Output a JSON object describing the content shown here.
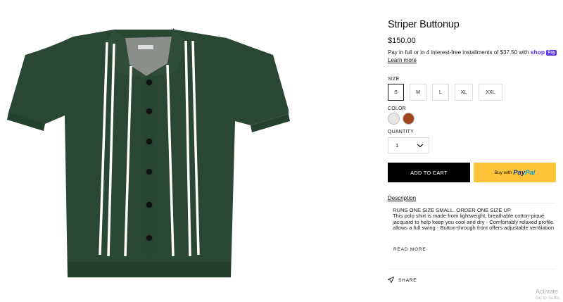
{
  "product": {
    "title": "Striper Buttonup",
    "price": "$150.00",
    "installments_text": "Pay in full or in 4 interest-free installments of $37.50 with",
    "shoppay_label": "shop",
    "shoppay_badge": "Pay",
    "learn_more": "Learn more",
    "image_alt": "Dark green knit short-sleeve polo buttonup with white vertical stripes"
  },
  "size": {
    "label": "SIZE",
    "options": [
      "S",
      "M",
      "L",
      "XL",
      "XXL"
    ],
    "selected": "S"
  },
  "color": {
    "label": "COLOR",
    "swatches": [
      "#e6e6e6",
      "#a0461c"
    ]
  },
  "quantity": {
    "label": "QUANTITY",
    "value": "1"
  },
  "actions": {
    "add_to_cart": "ADD TO CART",
    "buy_with": "Buy with",
    "paypal_pay": "Pay",
    "paypal_pal": "Pal"
  },
  "description": {
    "heading": "Description",
    "line1": "RUNS ONE SIZE SMALL. ORDER ONE SIZE UP",
    "body": "This polo shirt is made from lightweight, breathable cotton-piqué jacquard to help keep you cool and dry - Comfortably relaxed profile allows a full swing - Button-through front offers adjustable ventilation",
    "read_more": "READ MORE"
  },
  "share": {
    "label": "SHARE"
  },
  "watermark": {
    "line1": "Activate",
    "line2": "Go to Settin"
  },
  "colors": {
    "shirt": "#2a4634",
    "stripe": "#ffffff",
    "paypal_yellow": "#ffc439",
    "shoppay_purple": "#5a31f4"
  }
}
